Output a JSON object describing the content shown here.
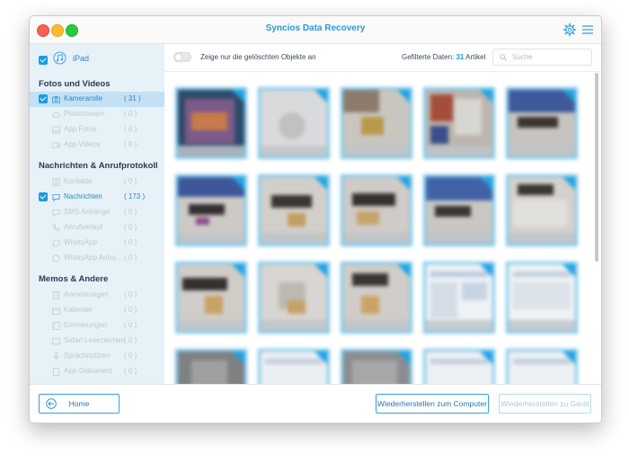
{
  "window": {
    "title": "Syncios Data Recovery"
  },
  "titlebar_icons": [
    "gear-icon",
    "menu-icon"
  ],
  "device": {
    "name": "iPad",
    "checked": true
  },
  "sidebar": {
    "sections": [
      {
        "title": "Fotos und Videos",
        "items": [
          {
            "label": "Kamerarolle",
            "count": "( 31 )",
            "checked": true,
            "selected": true,
            "icon": "camera-icon"
          },
          {
            "label": "Photostream",
            "count": "( 0 )",
            "icon": "cloud-icon"
          },
          {
            "label": "App Fotos",
            "count": "( 0 )",
            "icon": "photo-icon"
          },
          {
            "label": "App Videos",
            "count": "( 0 )",
            "icon": "video-icon"
          }
        ]
      },
      {
        "title": "Nachrichten & Anrufprotokoll",
        "items": [
          {
            "label": "Kontakte",
            "count": "( 0 )",
            "icon": "contacts-icon"
          },
          {
            "label": "Nachrichten",
            "count": "( 173 )",
            "checked": true,
            "icon": "message-icon"
          },
          {
            "label": "SMS Anhänge",
            "count": "( 0 )",
            "icon": "attachment-icon"
          },
          {
            "label": "Anrufverlauf",
            "count": "( 0 )",
            "icon": "phone-icon"
          },
          {
            "label": "WhatsApp",
            "count": "( 0 )",
            "icon": "whatsapp-icon"
          },
          {
            "label": "WhatsApp Anha...",
            "count": "( 0 )",
            "icon": "attachment-icon"
          }
        ]
      },
      {
        "title": "Memos & Andere",
        "items": [
          {
            "label": "Anmerkungen",
            "count": "( 0 )",
            "icon": "note-icon"
          },
          {
            "label": "Kalender",
            "count": "( 0 )",
            "icon": "calendar-icon"
          },
          {
            "label": "Erinnerungen",
            "count": "( 0 )",
            "icon": "reminder-icon"
          },
          {
            "label": "Safari Lesezeichen",
            "count": "( 0 )",
            "icon": "bookmark-icon"
          },
          {
            "label": "Sprachnotizen",
            "count": "( 0 )",
            "icon": "voice-icon"
          },
          {
            "label": "App-Dokument",
            "count": "( 0 )",
            "icon": "document-icon"
          }
        ]
      }
    ]
  },
  "toolbar": {
    "toggle_label": "Zeige nur die gelöschten Objekte an",
    "filter_prefix": "Gefilterte Daten:",
    "filter_count": "31",
    "filter_suffix": "Artikel",
    "search_placeholder": "Suche"
  },
  "footer": {
    "home_label": "Home",
    "restore_computer_label": "Wiederherstellen zum Computer",
    "restore_device_label": "Wiederherstellen zu Gerät"
  },
  "colors": {
    "accent": "#1b9be1",
    "sidebar_bg": "#e6f1f8",
    "selected_bg": "#c3e1f3"
  }
}
